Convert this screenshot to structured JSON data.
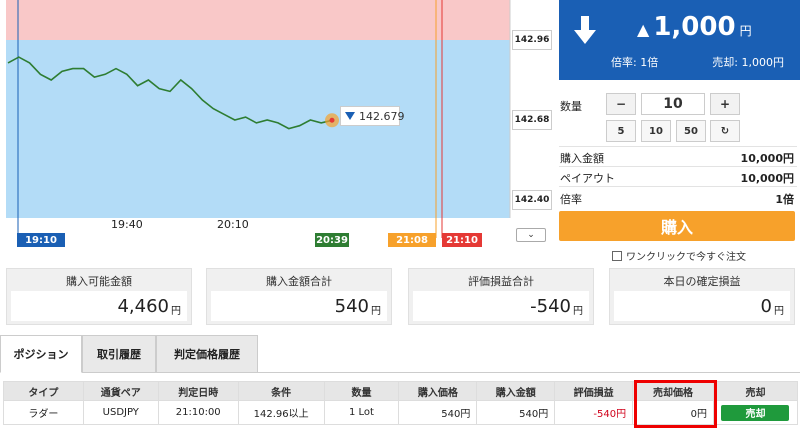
{
  "chart": {
    "price_levels": [
      "142.96",
      "142.68",
      "142.40"
    ],
    "time_axis": [
      "19:40",
      "20:10"
    ],
    "badges": [
      {
        "label": "19:10",
        "color": "#1a5fb4"
      },
      {
        "label": "20:39",
        "color": "#2e7d32"
      },
      {
        "label": "21:08",
        "color": "#f7a12b"
      },
      {
        "label": "21:10",
        "color": "#e53935"
      }
    ],
    "current_price": "142.679",
    "zones": {
      "upper": "#f9c8c8",
      "lower": "#b3dcf7"
    }
  },
  "order": {
    "price": "1,000",
    "yen": "円",
    "rate_text": "倍率: 1倍",
    "sell_text": "売却: 1,000円",
    "qty_label": "数量",
    "qty_value": "10",
    "minus": "−",
    "plus": "+",
    "quick": [
      "5",
      "10",
      "50"
    ],
    "rows": [
      {
        "label": "購入金額",
        "value": "10,000円"
      },
      {
        "label": "ペイアウト",
        "value": "10,000円"
      },
      {
        "label": "倍率",
        "value": "1倍"
      }
    ],
    "buy_label": "購入",
    "oneclick_label": "ワンクリックで今すぐ注文"
  },
  "summary": [
    {
      "title": "購入可能金額",
      "value": "4,460",
      "unit": "円"
    },
    {
      "title": "購入金額合計",
      "value": "540",
      "unit": "円"
    },
    {
      "title": "評価損益合計",
      "value": "-540",
      "unit": "円"
    },
    {
      "title": "本日の確定損益",
      "value": "0",
      "unit": "円"
    }
  ],
  "tabs": [
    "ポジション",
    "取引履歴",
    "判定価格履歴"
  ],
  "table": {
    "headers": [
      "タイプ",
      "通貨ペア",
      "判定日時",
      "条件",
      "数量",
      "購入価格",
      "購入金額",
      "評価損益",
      "売却価格",
      "売却"
    ],
    "row": {
      "type": "ラダー",
      "pair": "USDJPY",
      "time": "21:10:00",
      "condition": "142.96以上",
      "qty": "1 Lot",
      "buy_price": "540円",
      "amount": "540円",
      "pnl": "-540円",
      "sell_price": "0円",
      "sell_button": "売却"
    }
  },
  "chart_series_y": [
    142.88,
    142.9,
    142.88,
    142.84,
    142.82,
    142.85,
    142.86,
    142.86,
    142.83,
    142.84,
    142.86,
    142.84,
    142.8,
    142.82,
    142.79,
    142.78,
    142.82,
    142.79,
    142.75,
    142.72,
    142.7,
    142.68,
    142.69,
    142.67,
    142.68,
    142.67,
    142.65,
    142.66,
    142.68,
    142.67,
    142.679
  ]
}
